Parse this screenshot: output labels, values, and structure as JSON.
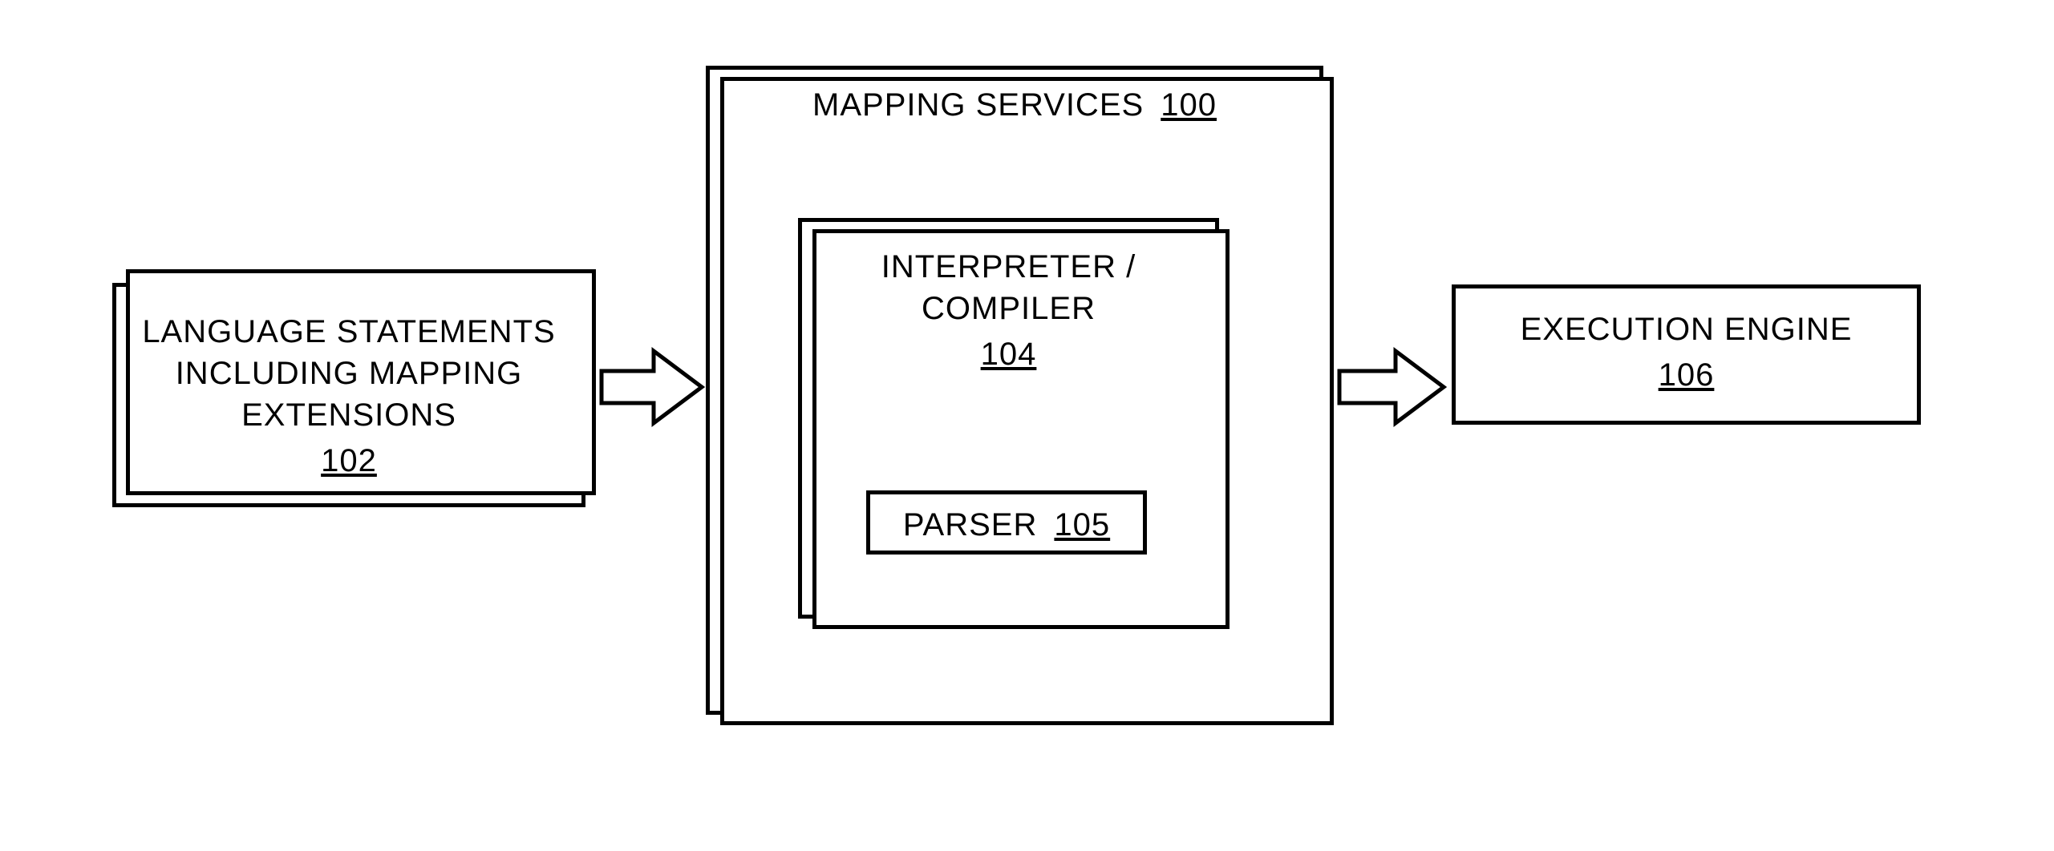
{
  "left_box": {
    "line1": "LANGUAGE STATEMENTS",
    "line2": "INCLUDING MAPPING",
    "line3": "EXTENSIONS",
    "ref": "102"
  },
  "mapping_services": {
    "title": "MAPPING SERVICES",
    "ref": "100"
  },
  "interpreter": {
    "line1": "INTERPRETER /",
    "line2": "COMPILER",
    "ref": "104"
  },
  "parser": {
    "label": "PARSER",
    "ref": "105"
  },
  "execution": {
    "label": "EXECUTION ENGINE",
    "ref": "106"
  }
}
